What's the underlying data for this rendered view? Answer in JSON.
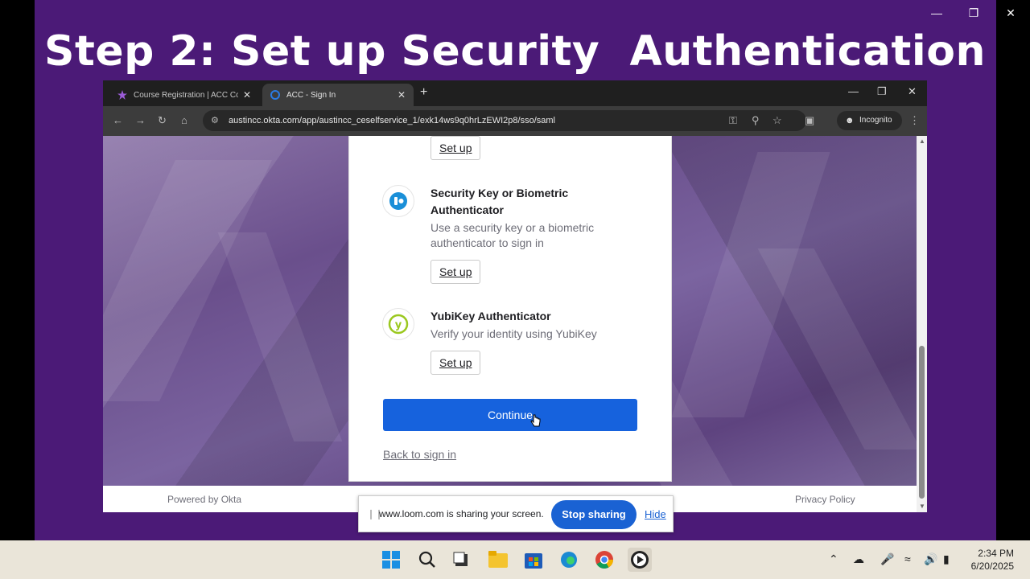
{
  "slide": {
    "title": "Step 2: Set up Security  Authentication"
  },
  "browser": {
    "tabs": [
      {
        "label": "Course Registration | ACC Conti"
      },
      {
        "label": "ACC - Sign In"
      }
    ],
    "url": "austincc.okta.com/app/austincc_ceselfservice_1/exk14ws9q0hrLzEWI2p8/sso/saml",
    "incognito_label": "Incognito"
  },
  "card": {
    "top_setup_label": "Set up",
    "authenticators": [
      {
        "title": "Security Key or Biometric Authenticator",
        "description": "Use a security key or a biometric authenticator to sign in",
        "button": "Set up"
      },
      {
        "title": "YubiKey Authenticator",
        "description": "Verify your identity using YubiKey",
        "button": "Set up"
      }
    ],
    "continue_label": "Continue",
    "back_link": "Back to sign in"
  },
  "footer": {
    "powered_by": "Powered by Okta",
    "privacy": "Privacy Policy"
  },
  "loom": {
    "message": "www.loom.com is sharing your screen.",
    "stop_label": "Stop sharing",
    "hide_label": "Hide"
  },
  "taskbar": {
    "time": "2:34 PM",
    "date": "6/20/2025"
  },
  "colors": {
    "slide_bg": "#4b1a77",
    "continue_btn": "#1662dd",
    "loom_stop": "#1a62d3"
  }
}
